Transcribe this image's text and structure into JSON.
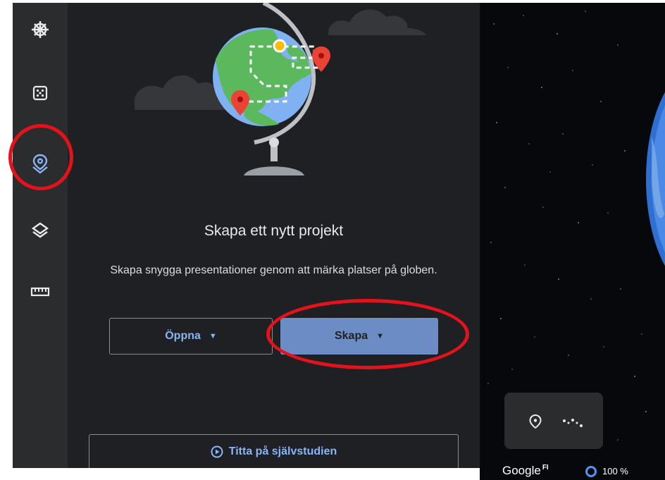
{
  "panel": {
    "title": "Skapa ett nytt projekt",
    "description": "Skapa snygga presentationer genom att märka platser på globen.",
    "open_label": "Öppna",
    "create_label": "Skapa",
    "tutorial_label": "Titta på självstudien"
  },
  "rail": {
    "items": [
      "compass-icon",
      "dice-icon",
      "projects-pin-icon",
      "layers-icon",
      "ruler-icon"
    ],
    "active_item": "projects-pin-icon"
  },
  "map": {
    "logo_text": "Google",
    "logo_region": "FI",
    "zoom_text": "100 %"
  },
  "colors": {
    "accent": "#8ab4f8",
    "create_button": "#6b8cc4",
    "highlight": "#e5121b"
  }
}
